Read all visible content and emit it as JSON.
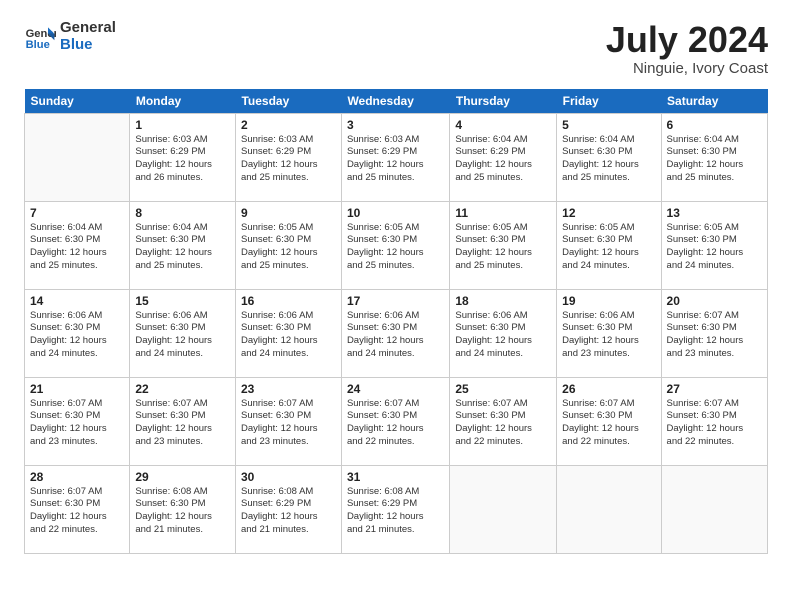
{
  "logo": {
    "line1": "General",
    "line2": "Blue"
  },
  "title": "July 2024",
  "location": "Ninguie, Ivory Coast",
  "days_of_week": [
    "Sunday",
    "Monday",
    "Tuesday",
    "Wednesday",
    "Thursday",
    "Friday",
    "Saturday"
  ],
  "weeks": [
    [
      {
        "day": "",
        "info": ""
      },
      {
        "day": "1",
        "info": "Sunrise: 6:03 AM\nSunset: 6:29 PM\nDaylight: 12 hours\nand 26 minutes."
      },
      {
        "day": "2",
        "info": "Sunrise: 6:03 AM\nSunset: 6:29 PM\nDaylight: 12 hours\nand 25 minutes."
      },
      {
        "day": "3",
        "info": "Sunrise: 6:03 AM\nSunset: 6:29 PM\nDaylight: 12 hours\nand 25 minutes."
      },
      {
        "day": "4",
        "info": "Sunrise: 6:04 AM\nSunset: 6:29 PM\nDaylight: 12 hours\nand 25 minutes."
      },
      {
        "day": "5",
        "info": "Sunrise: 6:04 AM\nSunset: 6:30 PM\nDaylight: 12 hours\nand 25 minutes."
      },
      {
        "day": "6",
        "info": "Sunrise: 6:04 AM\nSunset: 6:30 PM\nDaylight: 12 hours\nand 25 minutes."
      }
    ],
    [
      {
        "day": "7",
        "info": ""
      },
      {
        "day": "8",
        "info": "Sunrise: 6:04 AM\nSunset: 6:30 PM\nDaylight: 12 hours\nand 25 minutes."
      },
      {
        "day": "9",
        "info": "Sunrise: 6:05 AM\nSunset: 6:30 PM\nDaylight: 12 hours\nand 25 minutes."
      },
      {
        "day": "10",
        "info": "Sunrise: 6:05 AM\nSunset: 6:30 PM\nDaylight: 12 hours\nand 25 minutes."
      },
      {
        "day": "11",
        "info": "Sunrise: 6:05 AM\nSunset: 6:30 PM\nDaylight: 12 hours\nand 25 minutes."
      },
      {
        "day": "12",
        "info": "Sunrise: 6:05 AM\nSunset: 6:30 PM\nDaylight: 12 hours\nand 24 minutes."
      },
      {
        "day": "13",
        "info": "Sunrise: 6:05 AM\nSunset: 6:30 PM\nDaylight: 12 hours\nand 24 minutes."
      }
    ],
    [
      {
        "day": "14",
        "info": ""
      },
      {
        "day": "15",
        "info": "Sunrise: 6:06 AM\nSunset: 6:30 PM\nDaylight: 12 hours\nand 24 minutes."
      },
      {
        "day": "16",
        "info": "Sunrise: 6:06 AM\nSunset: 6:30 PM\nDaylight: 12 hours\nand 24 minutes."
      },
      {
        "day": "17",
        "info": "Sunrise: 6:06 AM\nSunset: 6:30 PM\nDaylight: 12 hours\nand 24 minutes."
      },
      {
        "day": "18",
        "info": "Sunrise: 6:06 AM\nSunset: 6:30 PM\nDaylight: 12 hours\nand 24 minutes."
      },
      {
        "day": "19",
        "info": "Sunrise: 6:06 AM\nSunset: 6:30 PM\nDaylight: 12 hours\nand 23 minutes."
      },
      {
        "day": "20",
        "info": "Sunrise: 6:07 AM\nSunset: 6:30 PM\nDaylight: 12 hours\nand 23 minutes."
      }
    ],
    [
      {
        "day": "21",
        "info": ""
      },
      {
        "day": "22",
        "info": "Sunrise: 6:07 AM\nSunset: 6:30 PM\nDaylight: 12 hours\nand 23 minutes."
      },
      {
        "day": "23",
        "info": "Sunrise: 6:07 AM\nSunset: 6:30 PM\nDaylight: 12 hours\nand 23 minutes."
      },
      {
        "day": "24",
        "info": "Sunrise: 6:07 AM\nSunset: 6:30 PM\nDaylight: 12 hours\nand 22 minutes."
      },
      {
        "day": "25",
        "info": "Sunrise: 6:07 AM\nSunset: 6:30 PM\nDaylight: 12 hours\nand 22 minutes."
      },
      {
        "day": "26",
        "info": "Sunrise: 6:07 AM\nSunset: 6:30 PM\nDaylight: 12 hours\nand 22 minutes."
      },
      {
        "day": "27",
        "info": "Sunrise: 6:07 AM\nSunset: 6:30 PM\nDaylight: 12 hours\nand 22 minutes."
      }
    ],
    [
      {
        "day": "28",
        "info": "Sunrise: 6:07 AM\nSunset: 6:30 PM\nDaylight: 12 hours\nand 22 minutes."
      },
      {
        "day": "29",
        "info": "Sunrise: 6:08 AM\nSunset: 6:30 PM\nDaylight: 12 hours\nand 21 minutes."
      },
      {
        "day": "30",
        "info": "Sunrise: 6:08 AM\nSunset: 6:29 PM\nDaylight: 12 hours\nand 21 minutes."
      },
      {
        "day": "31",
        "info": "Sunrise: 6:08 AM\nSunset: 6:29 PM\nDaylight: 12 hours\nand 21 minutes."
      },
      {
        "day": "",
        "info": ""
      },
      {
        "day": "",
        "info": ""
      },
      {
        "day": "",
        "info": ""
      }
    ]
  ],
  "week1_sunday_info": "Sunrise: 6:04 AM\nSunset: 6:30 PM\nDaylight: 12 hours\nand 25 minutes.",
  "week2_sunday_info": "Sunrise: 6:04 AM\nSunset: 6:30 PM\nDaylight: 12 hours\nand 25 minutes.",
  "week3_sunday_info": "Sunrise: 6:06 AM\nSunset: 6:30 PM\nDaylight: 12 hours\nand 24 minutes.",
  "week4_sunday_info": "Sunrise: 6:07 AM\nSunset: 6:30 PM\nDaylight: 12 hours\nand 23 minutes."
}
